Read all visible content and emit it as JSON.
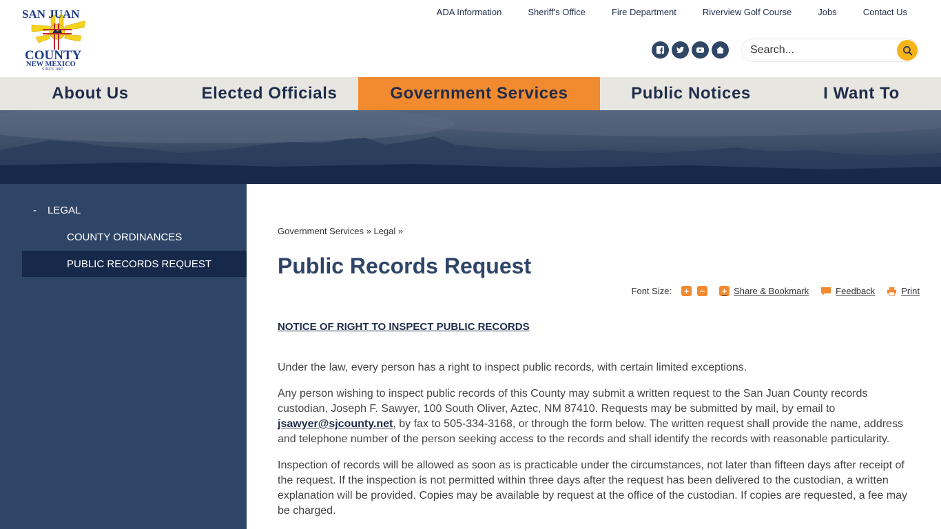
{
  "logo": {
    "line1": "SAN JUAN",
    "line2": "COUNTY",
    "line3": "NEW MEXICO",
    "line4": "SINCE 1887"
  },
  "topnav": [
    "ADA Information",
    "Sheriff's Office",
    "Fire Department",
    "Riverview Golf Course",
    "Jobs",
    "Contact Us"
  ],
  "social": [
    "facebook-icon",
    "twitter-icon",
    "youtube-icon",
    "home-icon"
  ],
  "search": {
    "placeholder": "Search..."
  },
  "mainnav": [
    {
      "label": "About Us",
      "active": false
    },
    {
      "label": "Elected Officials",
      "active": false
    },
    {
      "label": "Government Services",
      "active": true
    },
    {
      "label": "Public Notices",
      "active": false
    },
    {
      "label": "I Want To",
      "active": false
    }
  ],
  "sidebar": {
    "toggle": "-",
    "section": "LEGAL",
    "links": [
      {
        "label": "COUNTY ORDINANCES",
        "active": false
      },
      {
        "label": "PUBLIC RECORDS REQUEST",
        "active": true
      }
    ]
  },
  "breadcrumb": {
    "crumb1": "Government Services",
    "sep1": "»",
    "crumb2": "Legal",
    "sep2": "»"
  },
  "page": {
    "title": "Public Records Request",
    "notice": "NOTICE OF RIGHT TO INSPECT PUBLIC RECORDS"
  },
  "tools": {
    "font_size_label": "Font Size:",
    "increase": "+",
    "decrease": "−",
    "share_icon_glyph": "+",
    "share": "Share & Bookmark",
    "feedback": "Feedback",
    "print": "Print"
  },
  "paragraphs": {
    "p1": "Under the law, every person has a right to inspect public records, with certain limited exceptions.",
    "p2_before": "Any person wishing to inspect public records of this County may submit a written request to the San Juan County records custodian, Joseph F. Sawyer, 100 South Oliver, Aztec, NM  87410.  Requests may be submitted by mail, by email to ",
    "p2_email": "jsawyer@sjcounty.net",
    "p2_after": ", by fax to 505-334-3168, or through the form below. The written request shall provide the name, address and telephone number of the person seeking access to the records and shall identify the records with reasonable particularity.",
    "p3": "Inspection of records will be allowed as soon as is practicable under the circumstances, not later than fifteen days after receipt of the request.  If the inspection is not permitted within three days after the request has been delivered to the custodian, a written explanation will be provided.  Copies may be available by request at the office of the custodian.  If copies are requested, a fee may be charged."
  },
  "colors": {
    "navy": "#1f2d4a",
    "sidebar": "#2e4567",
    "sidebar_active": "#17294a",
    "accent_orange": "#f28a30",
    "search_yellow": "#f5b419",
    "nav_bg": "#e8e6e1"
  }
}
